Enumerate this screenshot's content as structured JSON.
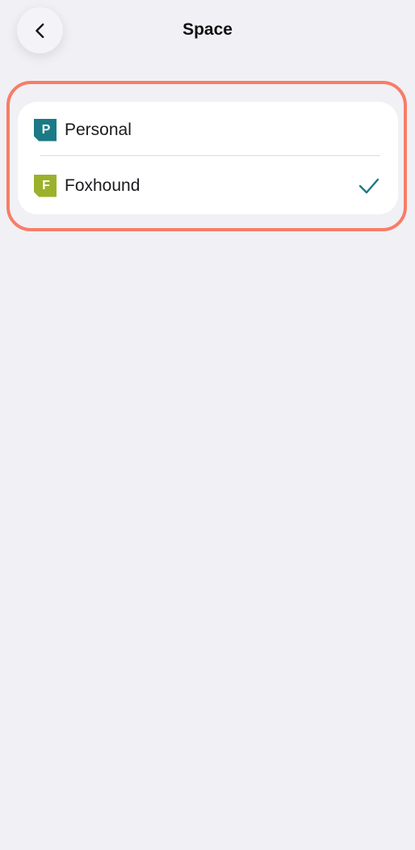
{
  "header": {
    "title": "Space",
    "back_icon": "chevron-left-icon"
  },
  "spaces": [
    {
      "label": "Personal",
      "initial": "P",
      "color": "#1b7a86",
      "selected": false
    },
    {
      "label": "Foxhound",
      "initial": "F",
      "color": "#9cb12b",
      "selected": true
    }
  ],
  "colors": {
    "background": "#f1f0f5",
    "highlight": "#f77d68",
    "check": "#1b7a86"
  },
  "selected_icon": "checkmark-icon"
}
